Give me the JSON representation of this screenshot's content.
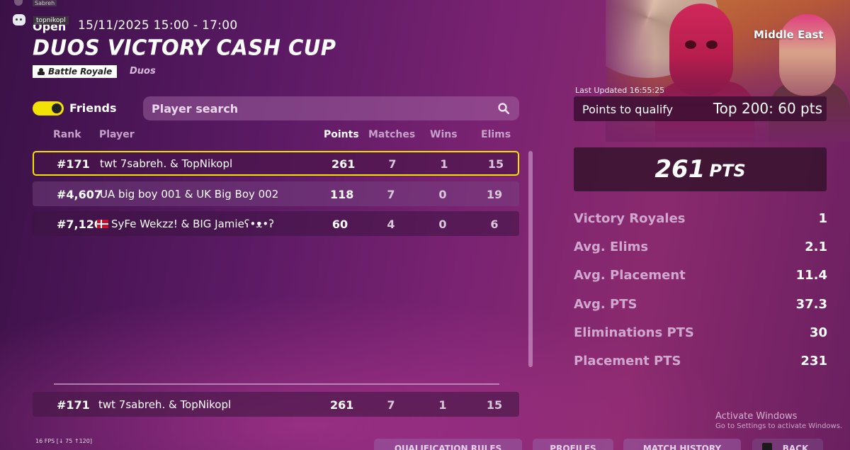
{
  "overlay": {
    "user_tag": "Sabreh",
    "discord_tooltip": "topnikopl",
    "fps": "16 FPS [↓ 75 ↑120]"
  },
  "event": {
    "status": "Open",
    "datetime": "15/11/2025 15:00 - 17:00",
    "title": "DUOS VICTORY CASH CUP",
    "mode": "Battle Royale",
    "team_size": "Duos"
  },
  "filters": {
    "friends_label": "Friends",
    "friends_on": true,
    "search_placeholder": "Player search"
  },
  "columns": {
    "rank": "Rank",
    "player": "Player",
    "points": "Points",
    "matches": "Matches",
    "wins": "Wins",
    "elims": "Elims"
  },
  "rows": [
    {
      "rank": "#171",
      "player": "twt 7sabreh. & TopNikopl",
      "flag": "",
      "points": "261",
      "matches": "7",
      "wins": "1",
      "elims": "15"
    },
    {
      "rank": "#4,607",
      "player": "UA big boy 001 & UK Big Boy 002",
      "flag": "",
      "points": "118",
      "matches": "7",
      "wins": "0",
      "elims": "19"
    },
    {
      "rank": "#7,120",
      "player": "SyFe Wekzz! & BIG Jamieʕ•ᴥ•ʔ",
      "flag": "denmark-flag",
      "points": "60",
      "matches": "4",
      "wins": "0",
      "elims": "6"
    }
  ],
  "my_row": {
    "rank": "#171",
    "player": "twt 7sabreh. & TopNikopl",
    "points": "261",
    "matches": "7",
    "wins": "1",
    "elims": "15"
  },
  "side": {
    "region": "Middle East",
    "last_updated": "Last Updated 16:55:25",
    "qualify_label": "Points to qualify",
    "qualify_value": "Top 200: 60 pts",
    "total_points": "261",
    "total_unit": "PTS",
    "stats": [
      {
        "label": "Victory Royales",
        "value": "1"
      },
      {
        "label": "Avg. Elims",
        "value": "2.1"
      },
      {
        "label": "Avg. Placement",
        "value": "11.4"
      },
      {
        "label": "Avg. PTS",
        "value": "37.3"
      },
      {
        "label": "Eliminations PTS",
        "value": "30"
      },
      {
        "label": "Placement PTS",
        "value": "231"
      }
    ]
  },
  "windows": {
    "activate_title": "Activate Windows",
    "activate_sub": "Go to Settings to activate Windows."
  },
  "buttons": {
    "qualification_rules": "QUALIFICATION RULES",
    "profiles": "PROFILES",
    "match_history": "MATCH HISTORY",
    "back": "BACK"
  },
  "colors": {
    "accent_yellow": "#f2e400",
    "background": "#6a1f5e"
  }
}
